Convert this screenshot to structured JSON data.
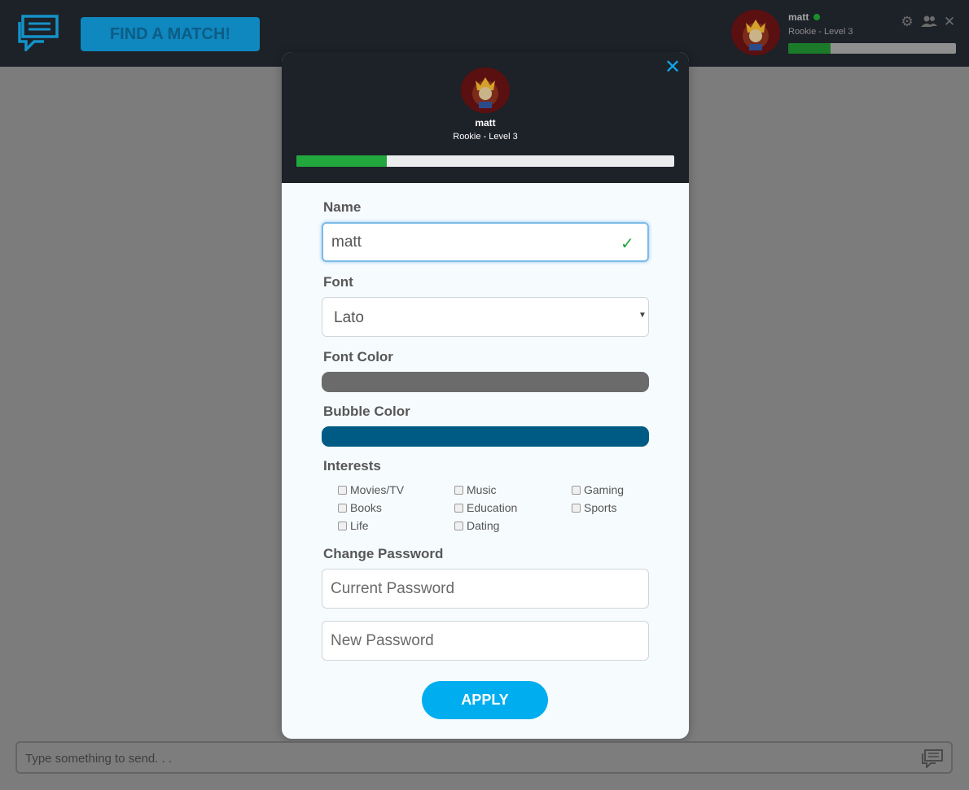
{
  "header": {
    "find_match_label": "FIND A MATCH!",
    "user": {
      "name": "matt",
      "level": "Rookie - Level 3",
      "online": true,
      "xp_progress_percent": 25
    },
    "icons": [
      "gear-icon",
      "friends-icon",
      "close-icon"
    ]
  },
  "modal": {
    "user": {
      "name": "matt",
      "level": "Rookie - Level 3",
      "xp_progress_percent": 24
    },
    "name": {
      "label": "Name",
      "value": "matt",
      "valid": true
    },
    "font": {
      "label": "Font",
      "value": "Lato",
      "options": [
        "Lato"
      ]
    },
    "font_color": {
      "label": "Font Color",
      "value": "#6b6b6b"
    },
    "bubble_color": {
      "label": "Bubble Color",
      "value": "#005b84"
    },
    "interests": {
      "label": "Interests",
      "items": [
        {
          "label": "Movies/TV",
          "checked": false
        },
        {
          "label": "Music",
          "checked": false
        },
        {
          "label": "Gaming",
          "checked": false
        },
        {
          "label": "Books",
          "checked": false
        },
        {
          "label": "Education",
          "checked": false
        },
        {
          "label": "Sports",
          "checked": false
        },
        {
          "label": "Life",
          "checked": false
        },
        {
          "label": "Dating",
          "checked": false
        }
      ]
    },
    "password": {
      "label": "Change Password",
      "current_placeholder": "Current Password",
      "new_placeholder": "New Password"
    },
    "apply_label": "APPLY"
  },
  "composer": {
    "placeholder": "Type something to send. . ."
  },
  "colors": {
    "accent": "#00aeef",
    "header_bg": "#1d2128",
    "progress_green": "#22a73c",
    "overlay_bg": "#7c7c7c"
  }
}
